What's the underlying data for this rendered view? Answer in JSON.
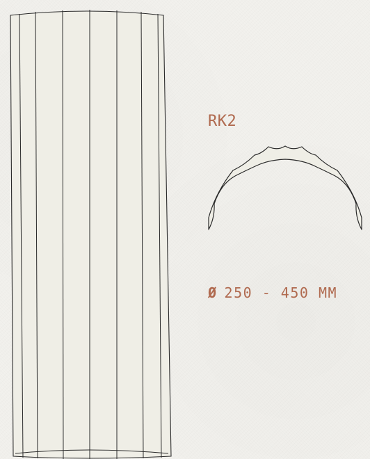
{
  "product": {
    "model": "RK2",
    "diameter_symbol": "Ø",
    "diameter_range": "250 - 450 MM"
  },
  "colors": {
    "label": "#b06a4f",
    "stroke": "#2a2a2a",
    "fill": "#efeee6",
    "background": "#f2f1ed"
  }
}
